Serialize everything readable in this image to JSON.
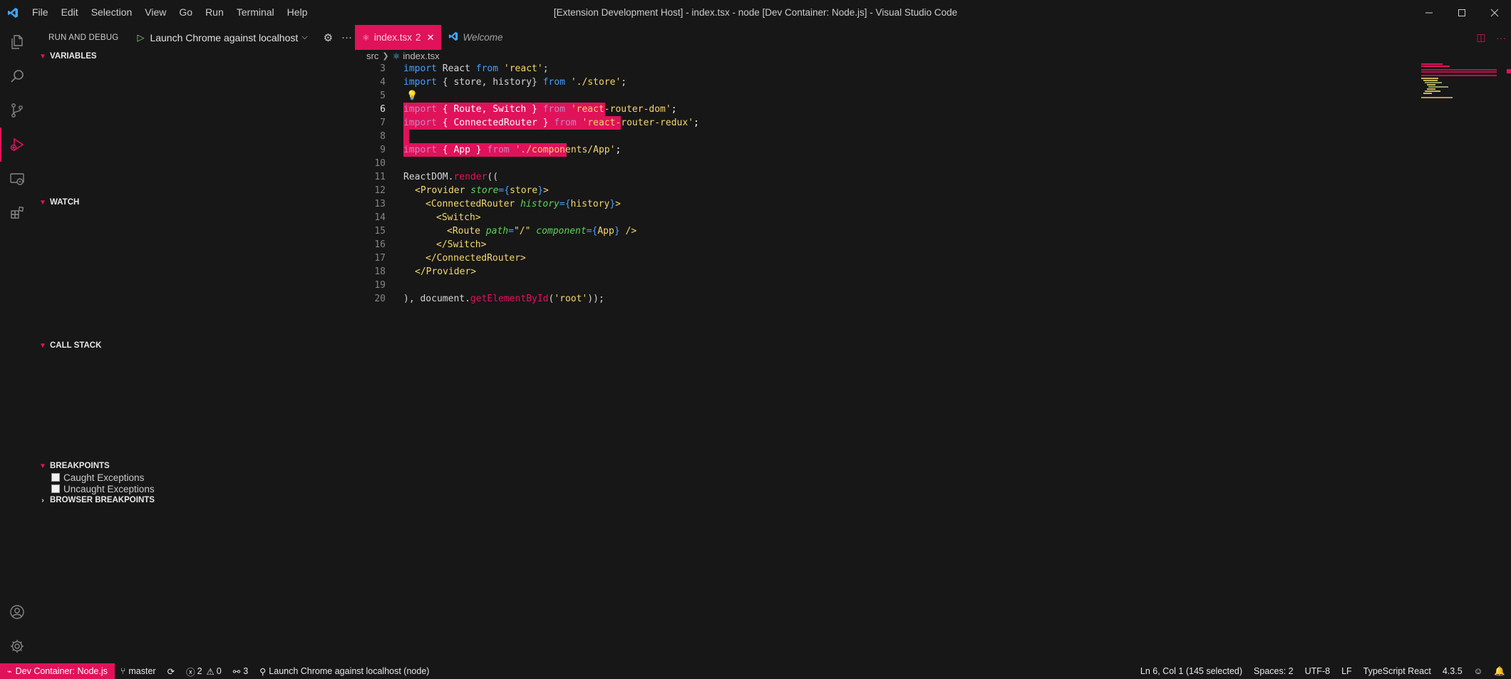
{
  "titlebar": {
    "menu": [
      "File",
      "Edit",
      "Selection",
      "View",
      "Go",
      "Run",
      "Terminal",
      "Help"
    ],
    "title": "[Extension Development Host] - index.tsx - node [Dev Container: Node.js] - Visual Studio Code"
  },
  "sidebar": {
    "title": "RUN AND DEBUG",
    "launch_config": "Launch Chrome against localhost",
    "sections": {
      "variables": "VARIABLES",
      "watch": "WATCH",
      "call_stack": "CALL STACK",
      "breakpoints": "BREAKPOINTS",
      "browser_breakpoints": "BROWSER BREAKPOINTS"
    },
    "breakpoint_items": [
      "Caught Exceptions",
      "Uncaught Exceptions"
    ]
  },
  "tabs": [
    {
      "label": "index.tsx",
      "count": "2",
      "active": true
    },
    {
      "label": "Welcome",
      "active": false
    }
  ],
  "breadcrumb": [
    "src",
    "index.tsx"
  ],
  "editor": {
    "line_numbers": [
      "3",
      "4",
      "5",
      "6",
      "7",
      "8",
      "9",
      "10",
      "11",
      "12",
      "13",
      "14",
      "15",
      "16",
      "17",
      "18",
      "19",
      "20"
    ],
    "code": {
      "l3": [
        "import",
        " React ",
        "from",
        " ",
        "'react'",
        ";"
      ],
      "l4": [
        "import",
        " { store, history} ",
        "from",
        " ",
        "'./store'",
        ";"
      ],
      "l6": [
        "import",
        " { Route, Switch } ",
        "from",
        " ",
        "'react-router-dom'",
        ";"
      ],
      "l7": [
        "import",
        " { ConnectedRouter } ",
        "from",
        " ",
        "'react-router-redux'",
        ";"
      ],
      "l9": [
        "import",
        " { App } ",
        "from",
        " ",
        "'./components/App'",
        ";"
      ],
      "l11": [
        "ReactDOM.",
        "render",
        "(("
      ],
      "l12": [
        "<Provider ",
        "store",
        "=",
        "{",
        "store",
        "}",
        ">"
      ],
      "l13": [
        "<ConnectedRouter ",
        "history",
        "=",
        "{",
        "history",
        "}",
        ">"
      ],
      "l14": [
        "<Switch>"
      ],
      "l15": [
        "<Route ",
        "path",
        "=",
        "\"/\"",
        " ",
        "component",
        "=",
        "{",
        "App",
        "}",
        " />"
      ],
      "l16": [
        "</Switch>"
      ],
      "l17": [
        "</ConnectedRouter>"
      ],
      "l18": [
        "</Provider>"
      ],
      "l20": [
        "), document.",
        "getElementById",
        "(",
        "'root'",
        "));"
      ]
    }
  },
  "statusbar": {
    "remote": "Dev Container: Node.js",
    "branch": "master",
    "errors": "2",
    "warnings": "0",
    "ports": "3",
    "debug": "Launch Chrome against localhost (node)",
    "cursor": "Ln 6, Col 1 (145 selected)",
    "spaces": "Spaces: 2",
    "encoding": "UTF-8",
    "eol": "LF",
    "language": "TypeScript React",
    "ts_version": "4.3.5"
  },
  "colors": {
    "accent": "#e0125a",
    "background": "#171717",
    "keyword": "#4a9eff",
    "string": "#f5d76e",
    "attribute": "#5ad45a"
  },
  "icons": {
    "app": "vscode-logo-icon",
    "activity": [
      "explorer-icon",
      "search-icon",
      "source-control-icon",
      "run-debug-icon",
      "remote-explorer-icon",
      "extensions-icon",
      "accounts-icon",
      "manage-gear-icon"
    ]
  }
}
